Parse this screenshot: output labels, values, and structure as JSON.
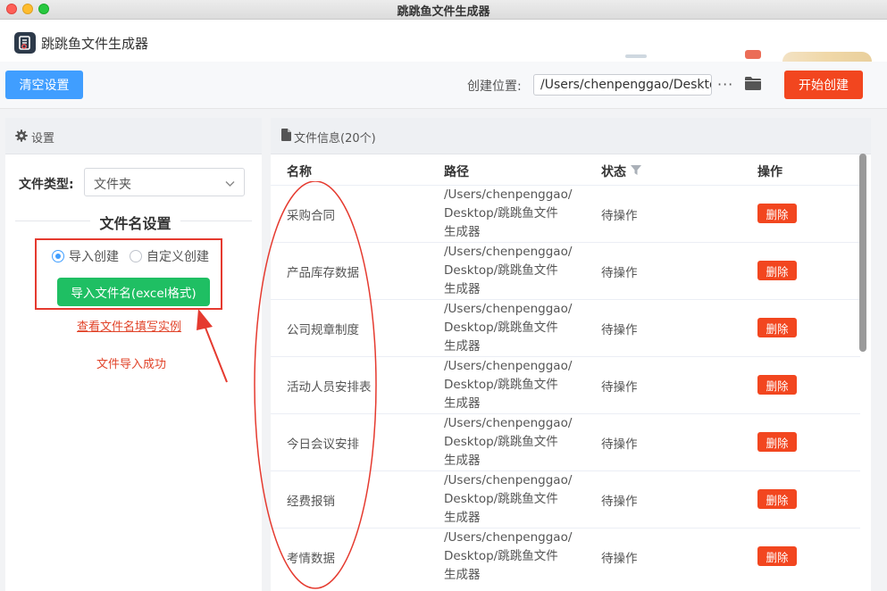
{
  "window": {
    "title": "跳跳鱼文件生成器"
  },
  "app": {
    "name": "跳跳鱼文件生成器"
  },
  "toolbar": {
    "clear_label": "清空设置",
    "location_label": "创建位置:",
    "location_value": "/Users/chenpenggao/Desktop",
    "more_label": "···",
    "start_label": "开始创建"
  },
  "settings": {
    "header": "设置",
    "file_type_label": "文件类型:",
    "file_type_value": "文件夹",
    "filename_section_title": "文件名设置",
    "mode_options": [
      "导入创建",
      "自定义创建"
    ],
    "selected_mode": "导入创建",
    "import_button_label": "导入文件名(excel格式)",
    "example_link": "查看文件名填写实例",
    "import_status": "文件导入成功"
  },
  "fileinfo": {
    "header": "文件信息(20个)",
    "columns": {
      "name": "名称",
      "path": "路径",
      "status": "状态",
      "action": "操作"
    },
    "rows": [
      {
        "name": "采购合同",
        "path": "/Users/chenpenggao/ Desktop/跳跳鱼文件 生成器",
        "status": "待操作",
        "action": "删除"
      },
      {
        "name": "产品库存数据",
        "path": "/Users/chenpenggao/ Desktop/跳跳鱼文件 生成器",
        "status": "待操作",
        "action": "删除"
      },
      {
        "name": "公司规章制度",
        "path": "/Users/chenpenggao/ Desktop/跳跳鱼文件 生成器",
        "status": "待操作",
        "action": "删除"
      },
      {
        "name": "活动人员安排表",
        "path": "/Users/chenpenggao/ Desktop/跳跳鱼文件 生成器",
        "status": "待操作",
        "action": "删除"
      },
      {
        "name": "今日会议安排",
        "path": "/Users/chenpenggao/ Desktop/跳跳鱼文件 生成器",
        "status": "待操作",
        "action": "删除"
      },
      {
        "name": "经费报销",
        "path": "/Users/chenpenggao/ Desktop/跳跳鱼文件 生成器",
        "status": "待操作",
        "action": "删除"
      },
      {
        "name": "考情数据",
        "path": "/Users/chenpenggao/ Desktop/跳跳鱼文件 生成器",
        "status": "待操作",
        "action": "删除"
      }
    ]
  },
  "colors": {
    "primary": "#409eff",
    "danger": "#f2461f",
    "success": "#1fbf63",
    "annotation": "#e53a2f"
  },
  "icons": [
    "app-logo-icon",
    "gear-icon",
    "document-icon",
    "folder-icon",
    "more-icon",
    "chevron-down-icon",
    "filter-icon"
  ]
}
